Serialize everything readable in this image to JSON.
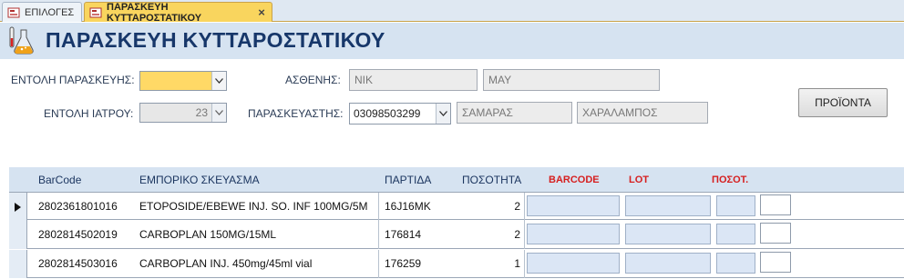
{
  "tabs": [
    {
      "label": "ΕΠΙΛΟΓΕΣ"
    },
    {
      "label": "ΠΑΡΑΣΚΕΥΗ ΚΥΤΤΑΡΟΣΤΑΤΙΚΟΥ"
    }
  ],
  "header": {
    "title": "ΠΑΡΑΣΚΕΥΗ ΚΥΤΤΑΡΟΣΤΑΤΙΚΟΥ"
  },
  "form": {
    "order_label": "ΕΝΤΟΛΗ ΠΑΡΑΣΚΕΥΗΣ:",
    "order_value": "",
    "doctor_order_label": "ΕΝΤΟΛΗ ΙΑΤΡΟΥ:",
    "doctor_order_value": "23",
    "patient_label": "ΑΣΘΕΝΗΣ:",
    "patient_first": "ΝΙΚ",
    "patient_last": "ΜΑΥ",
    "preparer_label": "ΠΑΡΑΣΚΕΥΑΣΤΗΣ:",
    "preparer_code": "03098503299",
    "preparer_surname": "ΣΑΜΑΡΑΣ",
    "preparer_name": "ΧΑΡΑΛΑΜΠΟΣ",
    "products_button": "ΠΡΟΪΟΝΤΑ"
  },
  "grid": {
    "headers": {
      "barcode": "BarCode",
      "product": "ΕΜΠΟΡΙΚΟ ΣΚΕΥΑΣΜΑ",
      "lot": "ΠΑΡΤΙΔΑ",
      "qty": "ΠΟΣΟΤΗΤΑ",
      "scan_barcode": "BARCODE",
      "scan_lot": "LOT",
      "scan_qty": "ΠΟΣΟΤ."
    },
    "rows": [
      {
        "barcode": "2802361801016",
        "product": "ETOPOSIDE/EBEWE INJ. SO. INF 100MG/5M",
        "lot": "16J16MK",
        "qty": "2"
      },
      {
        "barcode": "2802814502019",
        "product": "CARBOPLAN 150MG/15ML",
        "lot": "176814",
        "qty": "2"
      },
      {
        "barcode": "2802814503016",
        "product": "CARBOPLAN INJ. 450mg/45ml vial",
        "lot": "176259",
        "qty": "1"
      }
    ]
  },
  "colors": {
    "accent": "#f9d55e",
    "header_bg": "#d6e3f1",
    "title": "#17376a",
    "scan_header": "#d61f1f"
  },
  "icons": {
    "tab_icon": "form-icon",
    "logo": "lab-flask-icon",
    "dropdown": "chevron-down-icon",
    "record": "record-selector-icon"
  }
}
